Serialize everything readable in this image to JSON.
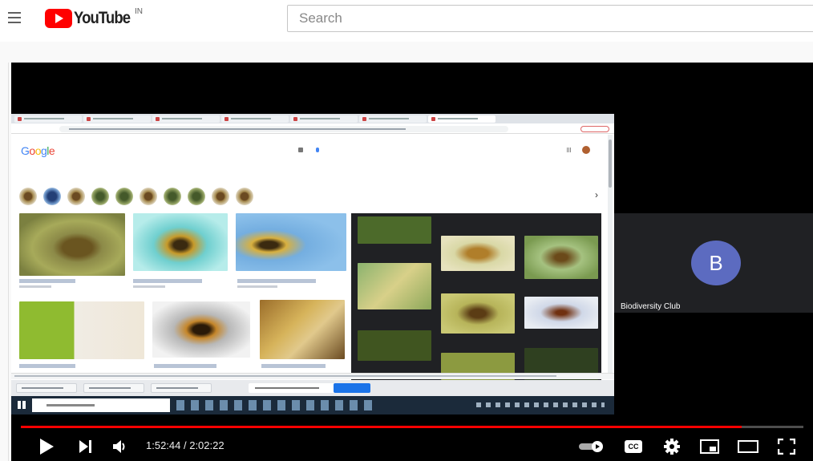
{
  "header": {
    "logo_text": "YouTube",
    "country_code": "IN",
    "search_placeholder": "Search"
  },
  "player": {
    "participant": {
      "initial": "B",
      "name": "Biodiversity Club",
      "avatar_color": "#5c6bc0"
    },
    "current_time": "1:52:44",
    "duration": "2:02:22",
    "time_display": "1:52:44 / 2:02:22",
    "progress": 0.921,
    "progress_color": "#ff0000"
  },
  "controls": {
    "icons": [
      "play-icon",
      "next-icon",
      "volume-icon",
      "autoplay-toggle",
      "captions-icon",
      "settings-icon",
      "miniplayer-icon",
      "theater-mode-icon",
      "fullscreen-icon"
    ],
    "captions_label": "CC"
  },
  "shared_screen": {
    "search_engine": "Google"
  }
}
